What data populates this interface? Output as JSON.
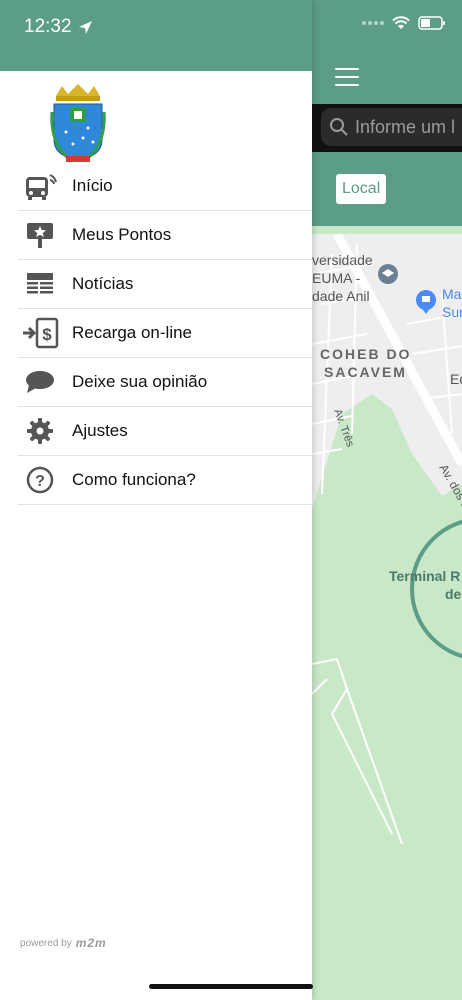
{
  "status_bar": {
    "time": "12:32"
  },
  "search": {
    "placeholder": "Informe um l"
  },
  "tabs": {
    "local_label": "Local"
  },
  "map": {
    "labels": [
      "versidade",
      "EUMA -",
      "dade Anil",
      "Ma",
      "Sur",
      "COHEB DO",
      "SACAVEM",
      "Ed",
      "Av. Três",
      "Av. dos P",
      "Terminal R",
      "de"
    ]
  },
  "menu": {
    "items": [
      {
        "label": "Início",
        "icon": "bus-icon"
      },
      {
        "label": "Meus Pontos",
        "icon": "bus-stop-icon"
      },
      {
        "label": "Notícias",
        "icon": "news-icon"
      },
      {
        "label": "Recarga on-line",
        "icon": "recharge-icon"
      },
      {
        "label": "Deixe sua opinião",
        "icon": "chat-bubble-icon"
      },
      {
        "label": "Ajustes",
        "icon": "gear-icon"
      },
      {
        "label": "Como funciona?",
        "icon": "help-icon"
      }
    ]
  },
  "footer": {
    "powered_by": "powered by",
    "brand": "m2m"
  },
  "colors": {
    "primary": "#5c9d88",
    "map_green": "#c8e8c8",
    "icon_gray": "#555555"
  }
}
